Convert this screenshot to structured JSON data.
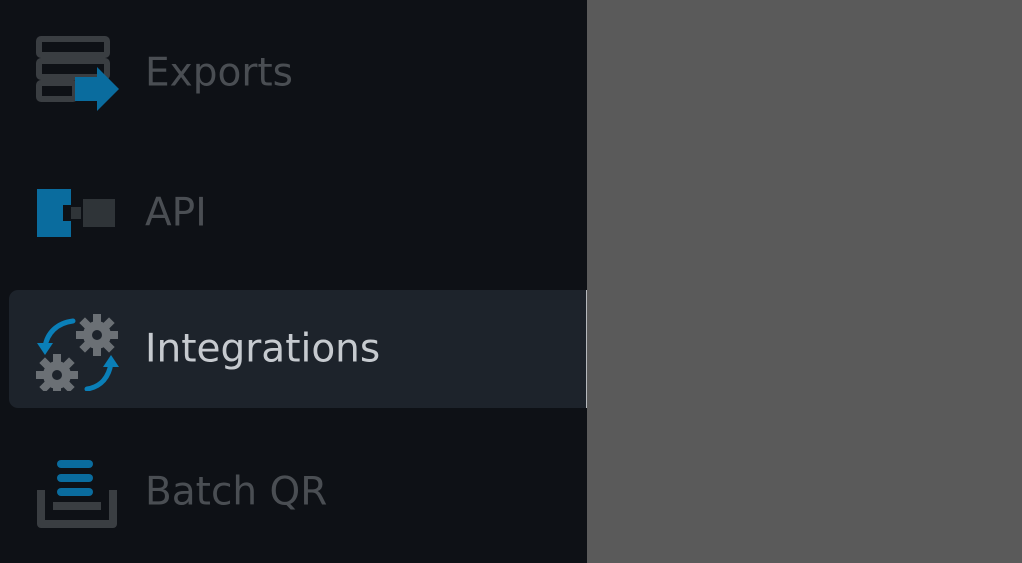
{
  "sidebar": {
    "items": [
      {
        "id": "exports",
        "label": "Exports",
        "icon": "exports-icon"
      },
      {
        "id": "api",
        "label": "API",
        "icon": "api-plug-icon"
      },
      {
        "id": "integrations",
        "label": "Integrations",
        "icon": "integrations-gears-icon",
        "active": true
      },
      {
        "id": "batch-qr",
        "label": "Batch QR",
        "icon": "batch-stack-icon"
      }
    ]
  },
  "colors": {
    "sidebar_bg": "#0e1116",
    "active_bg": "#1d232b",
    "overlay": "#5a5a5a",
    "accent_blue": "#0a6c9e",
    "icon_gray": "#3a3e42",
    "label_inactive": "#4a4e53",
    "label_active": "#c6cacf"
  }
}
